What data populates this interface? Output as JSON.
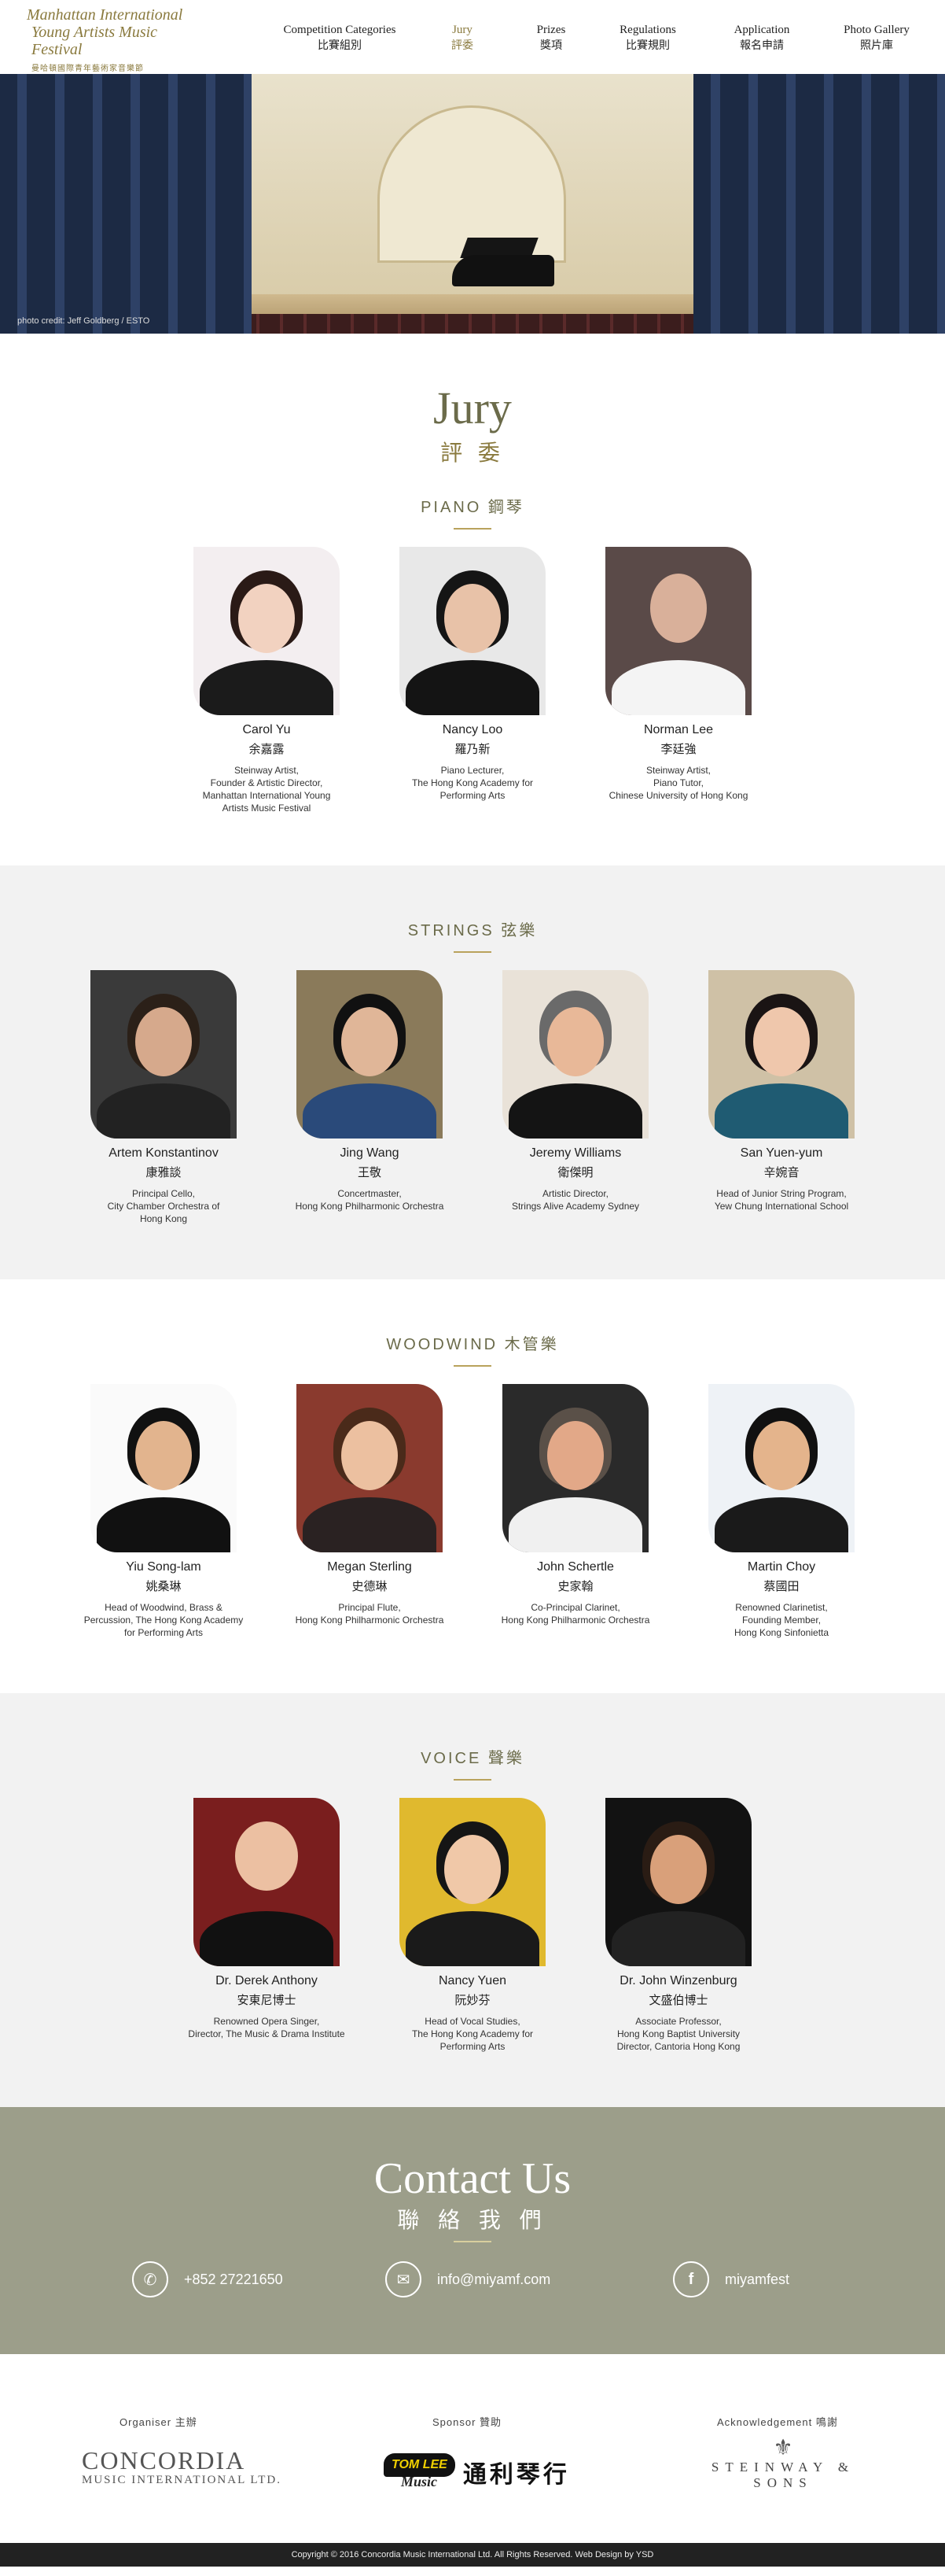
{
  "header": {
    "logo": {
      "line1": "Manhattan International",
      "line2": "Young Artists Music Festival",
      "line3": "曼哈頓國際青年藝術家音樂節"
    },
    "nav": [
      {
        "en": "Competition Categories",
        "zh": "比賽組別",
        "active": false
      },
      {
        "en": "Jury",
        "zh": "評委",
        "active": true
      },
      {
        "en": "Prizes",
        "zh": "獎項",
        "active": false
      },
      {
        "en": "Regulations",
        "zh": "比賽規則",
        "active": false
      },
      {
        "en": "Application",
        "zh": "報名申請",
        "active": false
      },
      {
        "en": "Photo Gallery",
        "zh": "照片庫",
        "active": false
      }
    ]
  },
  "hero": {
    "credit": "photo credit: Jeff Goldberg / ESTO"
  },
  "jury": {
    "title_en": "Jury",
    "title_zh": "評 委"
  },
  "sections": [
    {
      "title": "PIANO 鋼琴",
      "members": [
        {
          "name": "Carol Yu",
          "name_zh": "余嘉露",
          "role": "Steinway Artist,\nFounder & Artistic Director,\nManhattan International Young\nArtists Music Festival"
        },
        {
          "name": "Nancy Loo",
          "name_zh": "羅乃新",
          "role": "Piano Lecturer,\nThe Hong Kong Academy for\nPerforming Arts"
        },
        {
          "name": "Norman Lee",
          "name_zh": "李廷強",
          "role": "Steinway Artist,\nPiano Tutor,\nChinese University of Hong Kong"
        }
      ]
    },
    {
      "title": "STRINGS 弦樂",
      "members": [
        {
          "name": "Artem Konstantinov",
          "name_zh": "康雅談",
          "role": "Principal Cello,\nCity Chamber Orchestra of\nHong Kong"
        },
        {
          "name": "Jing Wang",
          "name_zh": "王敬",
          "role": "Concertmaster,\nHong Kong Philharmonic Orchestra"
        },
        {
          "name": "Jeremy Williams",
          "name_zh": "衛傑明",
          "role": "Artistic Director,\nStrings Alive Academy Sydney"
        },
        {
          "name": "San Yuen-yum",
          "name_zh": "辛婉音",
          "role": "Head of Junior String Program,\nYew Chung International School"
        }
      ]
    },
    {
      "title": "WOODWIND 木管樂",
      "members": [
        {
          "name": "Yiu Song-lam",
          "name_zh": "姚桑琳",
          "role": "Head of Woodwind, Brass &\nPercussion, The Hong Kong Academy\nfor Performing Arts"
        },
        {
          "name": "Megan Sterling",
          "name_zh": "史德琳",
          "role": "Principal Flute,\nHong Kong Philharmonic Orchestra"
        },
        {
          "name": "John Schertle",
          "name_zh": "史家翰",
          "role": "Co-Principal Clarinet,\nHong Kong Philharmonic Orchestra"
        },
        {
          "name": "Martin Choy",
          "name_zh": "蔡國田",
          "role": "Renowned Clarinetist,\nFounding Member,\nHong Kong Sinfonietta"
        }
      ]
    },
    {
      "title": "VOICE 聲樂",
      "members": [
        {
          "name": "Dr. Derek Anthony",
          "name_zh": "安東尼博士",
          "role": "Renowned Opera Singer,\nDirector, The Music & Drama Institute"
        },
        {
          "name": "Nancy Yuen",
          "name_zh": "阮妙芬",
          "role": "Head of Vocal Studies,\nThe Hong Kong Academy for\nPerforming Arts"
        },
        {
          "name": "Dr. John Winzenburg",
          "name_zh": "文盛伯博士",
          "role": "Associate Professor,\nHong Kong Baptist University\nDirector, Cantoria Hong Kong"
        }
      ]
    }
  ],
  "contact": {
    "title_en": "Contact Us",
    "title_zh": "聯 絡 我 們",
    "phone": "+852 27221650",
    "email": "info@miyamf.com",
    "facebook": "miyamfest"
  },
  "sponsors": {
    "organiser_label": "Organiser   主辦",
    "sponsor_label": "Sponsor   贊助",
    "ack_label": "Acknowledgement   鳴謝",
    "concordia_1": "CONCORDIA",
    "concordia_2": "MUSIC INTERNATIONAL LTD.",
    "tomlee_badge": "TOM LEE",
    "tomlee_sub": "Music",
    "tomlee_zh": "通利琴行",
    "steinway": "STEINWAY & SONS"
  },
  "footer": {
    "copyright": "Copyright © 2016 Concordia Music International Ltd. All Rights Reserved. Web Design by YSD"
  }
}
